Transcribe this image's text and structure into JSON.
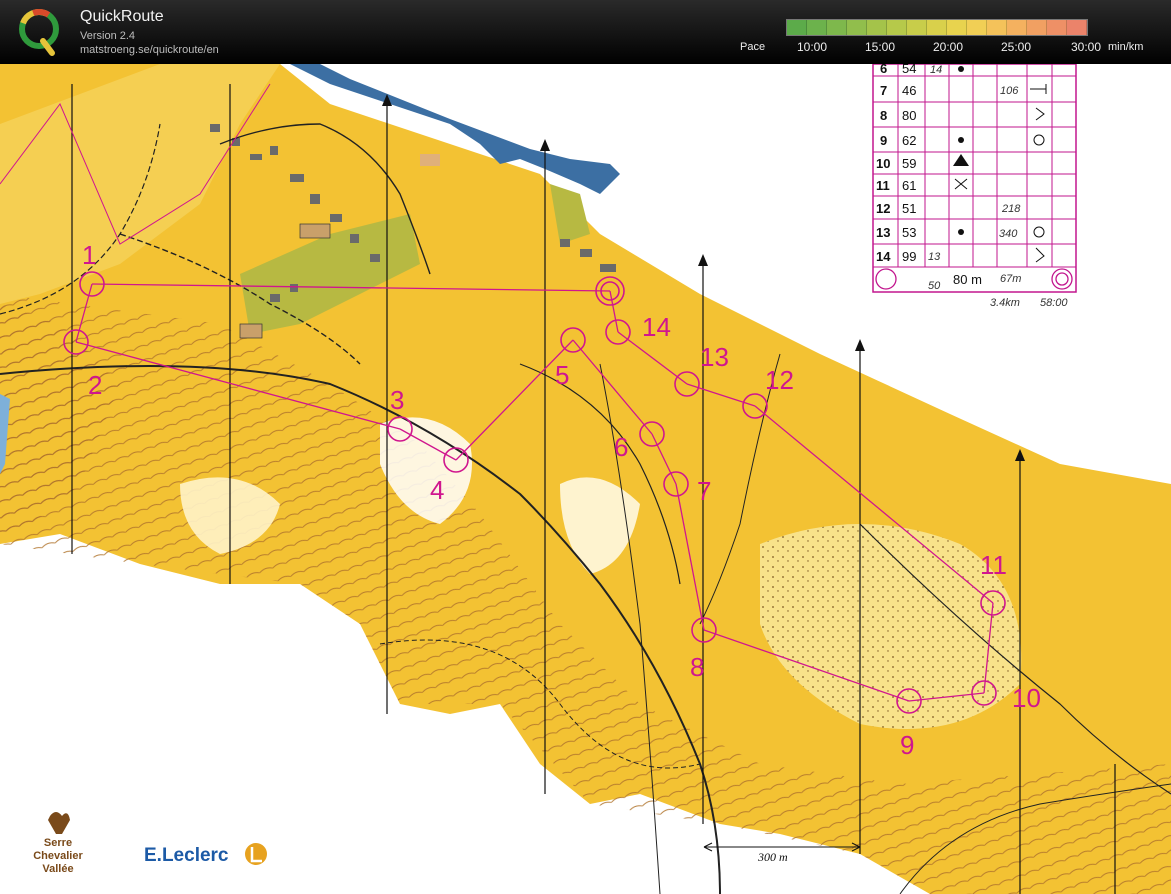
{
  "app": {
    "title": "QuickRoute",
    "version": "Version 2.4",
    "url": "matstroeng.se/quickroute/en"
  },
  "pace": {
    "label": "Pace",
    "ticks": [
      "10:00",
      "15:00",
      "20:00",
      "25:00",
      "30:00"
    ],
    "unit": "min/km",
    "colors": [
      "#5cab4a",
      "#6cb24c",
      "#7eb84c",
      "#91be4c",
      "#a4c34a",
      "#b6c94a",
      "#c8cd4a",
      "#d9d04b",
      "#e8d34e",
      "#f1cf55",
      "#f4c25a",
      "#f4b15f",
      "#f1a062",
      "#ee9066",
      "#eb836a"
    ]
  },
  "map": {
    "colors": {
      "yellow": "#f3c233",
      "pale": "#f8e28a",
      "course": "#d0168e",
      "olive": "#b7b942",
      "water": "#3c6fa3"
    },
    "controls": [
      {
        "num": "1"
      },
      {
        "num": "2"
      },
      {
        "num": "3"
      },
      {
        "num": "4"
      },
      {
        "num": "5"
      },
      {
        "num": "6"
      },
      {
        "num": "7"
      },
      {
        "num": "8"
      },
      {
        "num": "9"
      },
      {
        "num": "10"
      },
      {
        "num": "11"
      },
      {
        "num": "12"
      },
      {
        "num": "13"
      },
      {
        "num": "14"
      }
    ],
    "scale_label": "300 m",
    "description_table": {
      "rows": [
        {
          "num": "6",
          "code": "54",
          "c": "14"
        },
        {
          "num": "7",
          "code": "46",
          "c": "106"
        },
        {
          "num": "8",
          "code": "80",
          "c": ""
        },
        {
          "num": "9",
          "code": "62",
          "c": ""
        },
        {
          "num": "10",
          "code": "59",
          "c": ""
        },
        {
          "num": "11",
          "code": "61",
          "c": ""
        },
        {
          "num": "12",
          "code": "51",
          "c": "218"
        },
        {
          "num": "13",
          "code": "53",
          "c": "340"
        },
        {
          "num": "14",
          "code": "99",
          "c": "13"
        }
      ],
      "footer": "80 m",
      "footer_note": "67m",
      "handwritten_distance": "3.4km",
      "handwritten_time": "58:00",
      "small_50": "50"
    },
    "logos": {
      "serre_line1": "Serre",
      "serre_line2": "Chevalier",
      "serre_line3": "Vallée",
      "leclerc": "E.Leclerc"
    }
  }
}
